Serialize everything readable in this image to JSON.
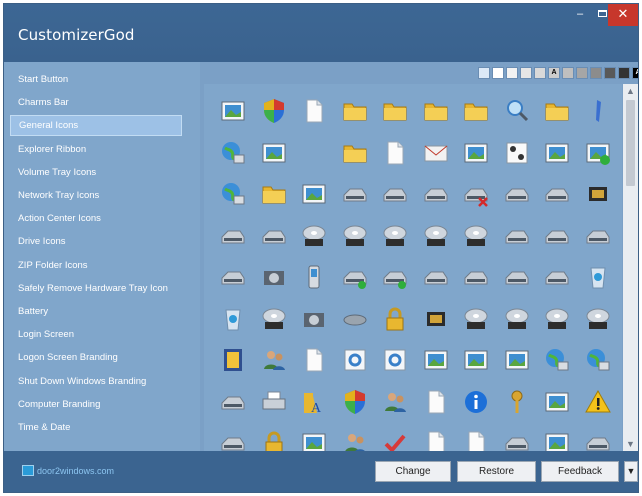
{
  "app": {
    "title": "CustomizerGod",
    "accent": "#3b6490",
    "panel_bg": "#80a6cb",
    "close_color": "#c7372c"
  },
  "window_controls": {
    "minimize": "–",
    "close": "✕"
  },
  "sidebar": {
    "items": [
      {
        "label": "Start Button"
      },
      {
        "label": "Charms Bar"
      },
      {
        "label": "General Icons",
        "selected": true
      },
      {
        "label": "Explorer Ribbon"
      },
      {
        "label": "Volume Tray Icons"
      },
      {
        "label": "Network Tray Icons"
      },
      {
        "label": "Action Center Icons"
      },
      {
        "label": "Drive Icons"
      },
      {
        "label": "ZIP Folder Icons"
      },
      {
        "label": "Safely Remove Hardware Tray Icon"
      },
      {
        "label": "Battery"
      },
      {
        "label": "Login Screen"
      },
      {
        "label": "Logon Screen Branding"
      },
      {
        "label": "Shut Down Windows Branding"
      },
      {
        "label": "Computer Branding"
      },
      {
        "label": "Time & Date"
      }
    ]
  },
  "background_swatches": [
    "#dce9f7",
    "#ffffff",
    "#f2f2f2",
    "#e6e6e6",
    "#d9d9d9",
    "#cccccc",
    "#bfbfbf",
    "#a6a6a6",
    "#8c8c8c",
    "#595959",
    "#333333",
    "#000000"
  ],
  "swatch_letters": {
    "5": "A",
    "11": "A"
  },
  "icon_grid": {
    "rows": [
      [
        "screen-icon",
        "shield-icon",
        "document-icon",
        "folder-icon",
        "folder-icon",
        "folder-icon",
        "folder-icon",
        "search-icon",
        "folder-icon",
        "pen-icon"
      ],
      [
        "network-icon",
        "window-icon",
        "blank-icon",
        "folder-search-icon",
        "document-icon",
        "mail-icon",
        "picture-icon",
        "chess-icon",
        "film-icon",
        "check-window-icon"
      ],
      [
        "globe-icon",
        "folder-drive-icon",
        "control-panel-icon",
        "disk-icon",
        "disk-icon",
        "disk-icon",
        "disk-error-icon",
        "disk-icon",
        "disk-icon",
        "chip-icon"
      ],
      [
        "drive-icon",
        "drive-windows-icon",
        "drive-dvd-icon",
        "dvd-r-icon",
        "dvd-ram-icon",
        "dvd-rom-icon",
        "dvd-rw-icon",
        "drive-icon",
        "drive-icon",
        "drive-icon"
      ],
      [
        "network-drive-icon",
        "camera-icon",
        "phone-icon",
        "disk-check-icon",
        "disk-check-icon",
        "disk-icon",
        "disk-icon",
        "disk-icon",
        "disk-icon",
        "recycle-bin-icon"
      ],
      [
        "recycle-bin-icon",
        "dvd-icon",
        "camera-icon",
        "pipe-icon",
        "lock-icon",
        "memory-card-icon",
        "cd-icon",
        "cd-r-icon",
        "cd-rom-icon",
        "cd-rw-icon"
      ],
      [
        "book-icon",
        "person-icon",
        "search-file-icon",
        "gear-icon",
        "gear-icon",
        "picture-icon",
        "picture-icon",
        "picture-icon",
        "network-user-icon",
        "network-user-icon"
      ],
      [
        "drive-icon",
        "printer-icon",
        "font-icon",
        "shield-icon",
        "users-icon",
        "document-icon",
        "info-icon",
        "key-icon",
        "picture-icon",
        "warning-icon"
      ],
      [
        "disk-icon",
        "clock-icon",
        "window-icon",
        "users-icon",
        "check-icon",
        "document-icon",
        "document-icon",
        "disk-icon",
        "window-icon",
        "disk-icon"
      ]
    ]
  },
  "footer": {
    "logo_text": "door2windows.com",
    "change_label": "Change",
    "restore_label": "Restore",
    "feedback_label": "Feedback",
    "more_label": "▼"
  },
  "scrollbar": {
    "up": "▲",
    "down": "▼"
  }
}
